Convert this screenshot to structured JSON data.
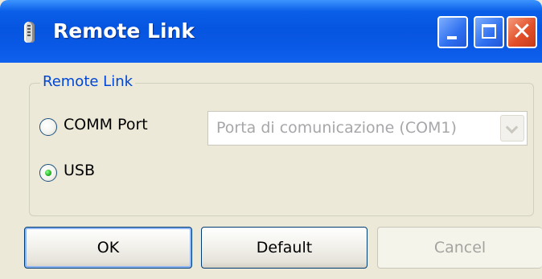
{
  "window": {
    "title": "Remote Link",
    "title_icon": "remote-device-icon",
    "buttons": {
      "minimize_icon": "minimize-icon",
      "maximize_icon": "maximize-icon",
      "close_icon": "close-icon",
      "close_glyph": "✕"
    }
  },
  "group": {
    "legend": "Remote Link",
    "options": [
      {
        "label": "COMM Port",
        "selected": false
      },
      {
        "label": "USB",
        "selected": true
      }
    ],
    "port_select": {
      "value": "Porta di comunicazione (COM1)",
      "enabled": false
    }
  },
  "actions": {
    "ok": "OK",
    "default": "Default",
    "cancel": "Cancel",
    "cancel_enabled": false
  },
  "colors": {
    "titlebar": "#0655e0",
    "legend": "#0046d5",
    "dialog_bg": "#ece9d8",
    "close_button": "#e2502a",
    "radio_dot": "#24b524"
  }
}
